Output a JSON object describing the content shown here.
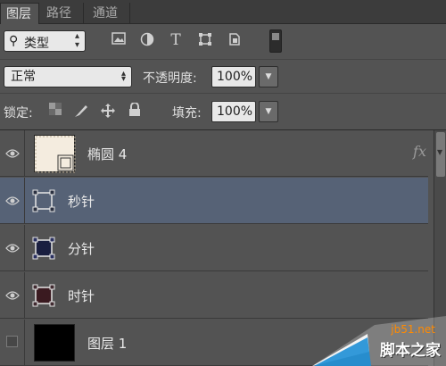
{
  "tabs": [
    {
      "label": "图层",
      "active": true
    },
    {
      "label": "路径",
      "active": false
    },
    {
      "label": "通道",
      "active": false
    }
  ],
  "filter": {
    "kind_label": "类型",
    "icons": [
      "image-filter-icon",
      "adjustment-filter-icon",
      "type-filter-icon",
      "shape-filter-icon",
      "smart-object-filter-icon"
    ]
  },
  "blend": {
    "mode": "正常",
    "opacity_label": "不透明度:",
    "opacity_value": "100%"
  },
  "lock": {
    "label": "锁定:",
    "fill_label": "填充:",
    "fill_value": "100%"
  },
  "layers": [
    {
      "name": "椭圆 4",
      "thumb": "cream",
      "fx": "fx",
      "selected": false
    },
    {
      "name": "秒针",
      "thumb": "shape",
      "selected": true
    },
    {
      "name": "分针",
      "thumb": "shape",
      "selected": false
    },
    {
      "name": "时针",
      "thumb": "shape",
      "selected": false
    },
    {
      "name": "图层 1",
      "thumb": "black",
      "selected": false
    }
  ],
  "watermark": {
    "site": "jb51.net",
    "brand": "脚本之家"
  },
  "colors": {
    "panel_bg": "#535353",
    "selected_row": "#566276",
    "watermark_orange": "#ff8a00"
  }
}
